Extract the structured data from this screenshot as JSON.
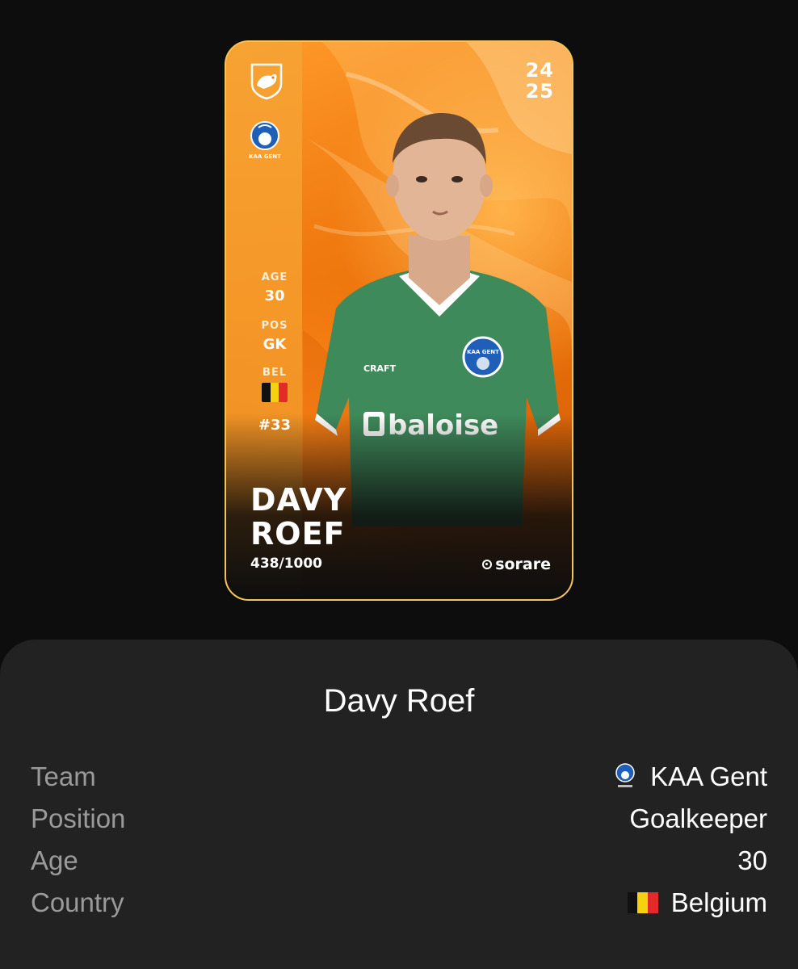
{
  "card": {
    "season_top": "24",
    "season_bottom": "25",
    "stats": [
      {
        "label": "AGE",
        "value": "30"
      },
      {
        "label": "POS",
        "value": "GK"
      },
      {
        "label": "BEL",
        "value": ""
      }
    ],
    "shirt_number": "#33",
    "name_line1": "DAVY",
    "name_line2": "ROEF",
    "serial": "438/1000",
    "brand": "sorare",
    "club_crest_text": "KAA GENT",
    "jersey_sponsor": "baloise",
    "jersey_maker": "CRAFT",
    "colors": {
      "rarity_orange": "#f07a10",
      "border_gold": "#f2c45a",
      "jersey_green": "#3f8a5b"
    }
  },
  "sheet": {
    "title": "Davy Roef",
    "rows": [
      {
        "label": "Team",
        "value": "KAA Gent",
        "icon": "club-crest-icon"
      },
      {
        "label": "Position",
        "value": "Goalkeeper"
      },
      {
        "label": "Age",
        "value": "30"
      },
      {
        "label": "Country",
        "value": "Belgium",
        "icon": "belgium-flag-icon"
      }
    ]
  },
  "flag_colors": {
    "black": "#111111",
    "yellow": "#f5d10f",
    "red": "#e32a2a"
  }
}
